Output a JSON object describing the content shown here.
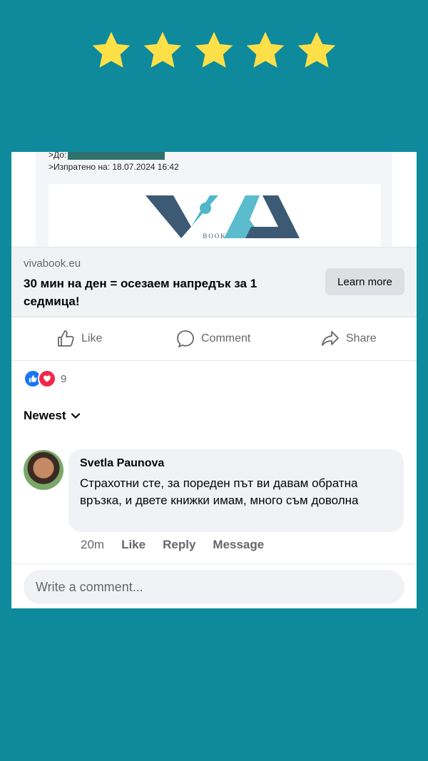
{
  "rating": {
    "stars": 5,
    "max": 5,
    "star_color": "#fde047",
    "background": "#0e8a9c"
  },
  "email": {
    "to_label": ">До:",
    "sent_label": ">Изпратено на: 18.07.2024 16:42",
    "logo_letters": "VIVA",
    "logo_subtext": "BOOK"
  },
  "link": {
    "domain": "vivabook.eu",
    "title": "30 мин на ден = осезаем напредък за 1 седмица!",
    "cta": "Learn more"
  },
  "actions": {
    "like": "Like",
    "comment": "Comment",
    "share": "Share"
  },
  "reactions": {
    "count": "9",
    "icons": [
      "like-icon",
      "heart-icon"
    ]
  },
  "comments": {
    "sort_label": "Newest",
    "items": [
      {
        "author": "Svetla Paunova",
        "text": "Страхотни сте, за пореден път ви давам обратна връзка, и двете книжки имам, много съм доволна",
        "time": "20m",
        "like": "Like",
        "reply": "Reply",
        "message": "Message"
      }
    ],
    "input_placeholder": "Write a comment..."
  }
}
